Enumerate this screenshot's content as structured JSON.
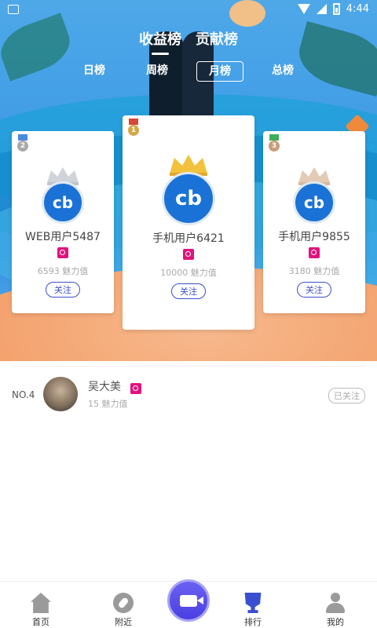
{
  "status_bar": {
    "time": "4:44"
  },
  "main_tabs": [
    {
      "label": "收益榜",
      "active": true
    },
    {
      "label": "贡献榜",
      "active": false
    }
  ],
  "period_tabs": [
    {
      "label": "日榜",
      "active": false
    },
    {
      "label": "周榜",
      "active": false
    },
    {
      "label": "月榜",
      "active": true
    },
    {
      "label": "总榜",
      "active": false
    }
  ],
  "podium": {
    "first": {
      "rank": "1",
      "name": "手机用户6421",
      "charm": "10000 魅力值",
      "follow": "关注",
      "avatar_text": "cb"
    },
    "second": {
      "rank": "2",
      "name": "WEB用户5487",
      "charm": "6593 魅力值",
      "follow": "关注",
      "avatar_text": "cb"
    },
    "third": {
      "rank": "3",
      "name": "手机用户9855",
      "charm": "3180 魅力值",
      "follow": "关注",
      "avatar_text": "cb"
    }
  },
  "list": [
    {
      "rank": "NO.4",
      "name": "吴大美",
      "charm": "15 魅力值",
      "follow": "已关注"
    }
  ],
  "bottom_nav": {
    "home": "首页",
    "nearby": "附近",
    "ranking": "排行",
    "mine": "我的"
  },
  "colors": {
    "accent": "#3a4fd0",
    "level_badge": "#e0137e",
    "avatar_blue": "#1a72d6"
  }
}
